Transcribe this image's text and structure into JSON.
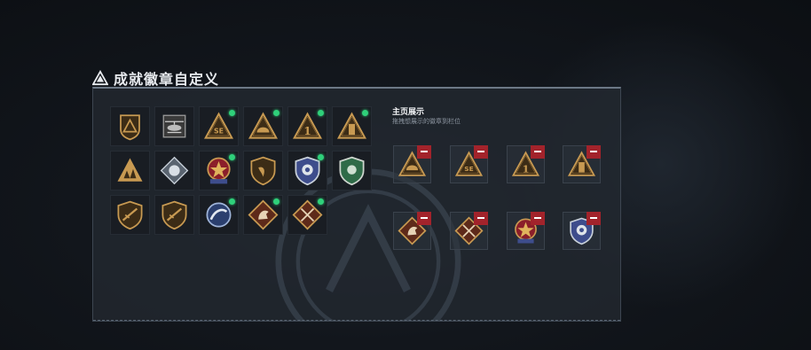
{
  "header": {
    "title": "成就徽章自定义",
    "icon": "warning-triangle-icon"
  },
  "collection": {
    "badges": [
      {
        "icon": "pyramid-shield-badge-icon",
        "new": false
      },
      {
        "icon": "helicopter-badge-icon",
        "new": false
      },
      {
        "icon": "se-triangle-badge-icon",
        "new": true
      },
      {
        "icon": "helmet-triangle-badge-icon",
        "new": true
      },
      {
        "icon": "number-one-triangle-badge-icon",
        "new": true
      },
      {
        "icon": "tower-triangle-badge-icon",
        "new": true
      },
      {
        "icon": "soldiers-triangle-badge-icon",
        "new": false
      },
      {
        "icon": "diamond-emblem-badge-icon",
        "new": false
      },
      {
        "icon": "star-medal-badge-icon",
        "new": true
      },
      {
        "icon": "wing-shield-badge-icon",
        "new": false
      },
      {
        "icon": "police-shield-blue-badge-icon",
        "new": true
      },
      {
        "icon": "green-shield-badge-icon",
        "new": false
      },
      {
        "icon": "rifle-shield-badge-icon",
        "new": false
      },
      {
        "icon": "rifle-shield-badge-icon",
        "new": false
      },
      {
        "icon": "blue-crest-badge-icon",
        "new": true
      },
      {
        "icon": "horse-diamond-badge-icon",
        "new": true
      },
      {
        "icon": "swords-diamond-badge-icon",
        "new": true
      }
    ]
  },
  "showcase": {
    "title": "主页展示",
    "subtitle": "拖拽想展示的徽章到栏位",
    "slots": [
      {
        "icon": "helmet-triangle-badge-icon"
      },
      {
        "icon": "se-triangle-badge-icon"
      },
      {
        "icon": "number-one-triangle-badge-icon"
      },
      {
        "icon": "tower-triangle-badge-icon"
      },
      {
        "icon": "horse-diamond-badge-icon"
      },
      {
        "icon": "swords-diamond-badge-icon"
      },
      {
        "icon": "star-medal-badge-icon"
      },
      {
        "icon": "police-shield-blue-badge-icon"
      }
    ],
    "remove_icon": "minus-icon"
  },
  "colors": {
    "gold": "#c89a52",
    "dark_gold": "#3c2c16",
    "new_dot": "#2fd07a",
    "remove": "#a2232b",
    "police_blue": "#3e4d8c",
    "green_shield": "#2f6b48"
  }
}
